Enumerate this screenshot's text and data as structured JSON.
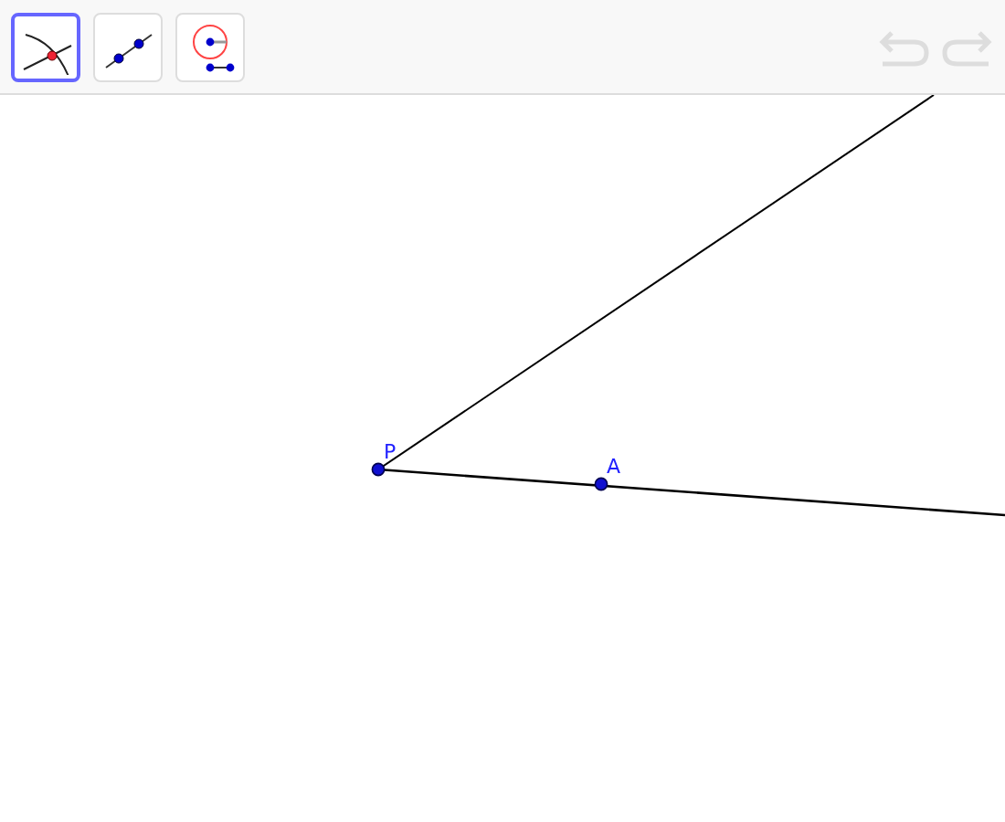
{
  "toolbar": {
    "tools": [
      {
        "kind": "intersect",
        "selected": true
      },
      {
        "kind": "line",
        "selected": false
      },
      {
        "kind": "circle",
        "selected": false
      }
    ],
    "undo": {
      "disabled": true
    },
    "redo": {
      "disabled": true
    }
  },
  "canvas": {
    "points": [
      {
        "label": "P"
      },
      {
        "label": "A"
      }
    ]
  }
}
